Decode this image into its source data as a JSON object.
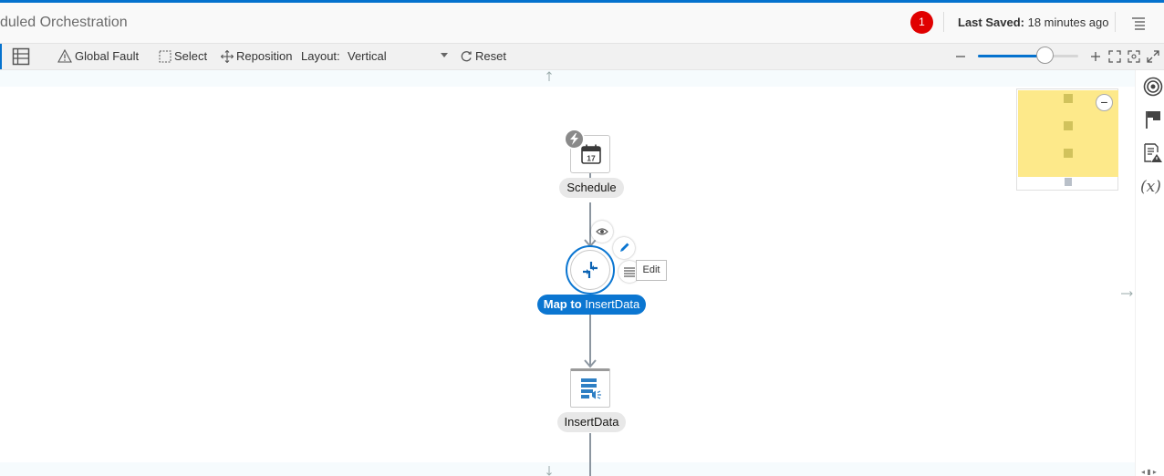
{
  "header": {
    "title": "duled Orchestration",
    "notification_count": "1",
    "last_saved_label": "Last Saved:",
    "last_saved_value": "18 minutes ago"
  },
  "toolbar": {
    "global_fault": "Global Fault",
    "select": "Select",
    "reposition": "Reposition",
    "layout_label": "Layout:",
    "layout_value": "Vertical",
    "reset": "Reset",
    "zoom_level": 0.67
  },
  "canvas": {
    "nodes": [
      {
        "label": "Schedule",
        "icon": "calendar-icon",
        "calendar_day": "17"
      },
      {
        "label_bold": "Map to",
        "label_rest": " InsertData",
        "icon": "map-icon"
      },
      {
        "label": "InsertData",
        "icon": "database-invoke-icon"
      }
    ],
    "edit_tooltip": "Edit"
  },
  "right_panel": {
    "icons": [
      "target-icon",
      "flag-icon",
      "report-warning-icon",
      "variable-icon"
    ],
    "variable_text": "(x)"
  },
  "colors": {
    "accent": "#0572ce",
    "active_node": "#0b76d1",
    "notification": "#e00000",
    "minimap": "#fde98a"
  }
}
